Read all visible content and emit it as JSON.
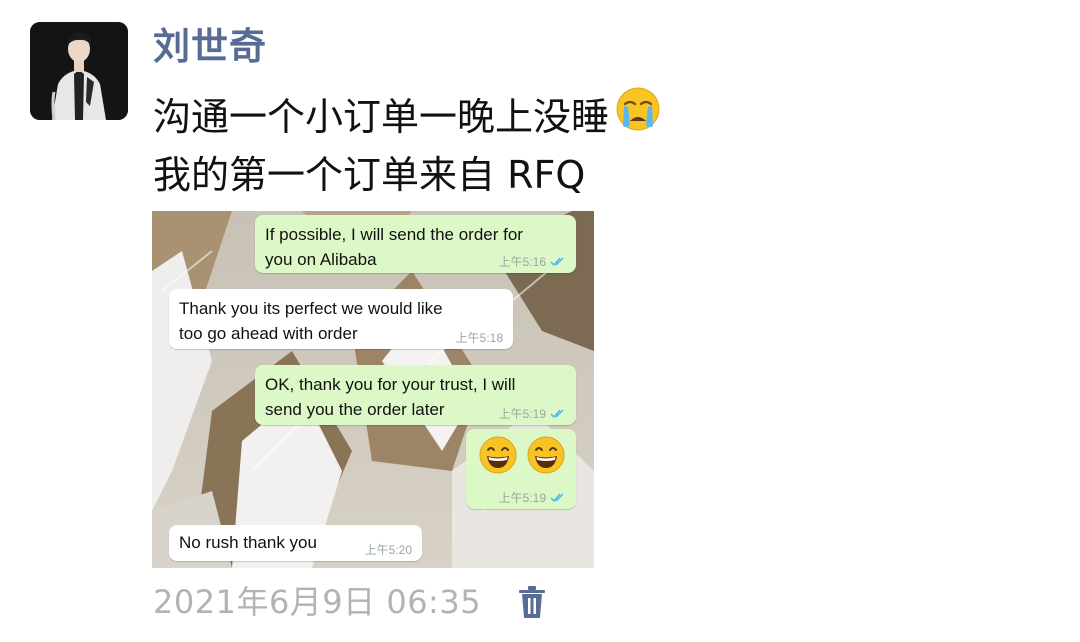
{
  "post": {
    "author": "刘世奇",
    "lines": [
      "沟通一个小订单一晚上没睡",
      "我的第一个订单来自 RFQ"
    ],
    "emoji": "crying-face",
    "timestamp": "2021年6月9日 06:35"
  },
  "chat": {
    "messages": [
      {
        "direction": "outgoing",
        "text": "If possible, I will send the order for\nyou on Alibaba",
        "time": "上午5:16",
        "read": true
      },
      {
        "direction": "incoming",
        "text": "Thank you  its perfect we would like\ntoo go ahead with order",
        "time": "上午5:18"
      },
      {
        "direction": "outgoing",
        "text": "OK, thank you for your trust, I will\nsend you the order later",
        "time": "上午5:19",
        "read": true
      },
      {
        "direction": "outgoing",
        "emojis": [
          "grinning-face",
          "grinning-face"
        ],
        "time": "上午5:19",
        "read": true
      },
      {
        "direction": "incoming",
        "text": "No rush thank you",
        "time": "上午5:20"
      }
    ]
  },
  "colors": {
    "author": "#576b95",
    "outgoing_bubble": "#dcf8c6",
    "incoming_bubble": "#ffffff",
    "read_ticks": "#4fb6ec",
    "timestamp": "#b3b3b3"
  },
  "icons": [
    "avatar",
    "crying-face-emoji",
    "grinning-face-emoji",
    "double-check-icon",
    "trash-icon"
  ]
}
